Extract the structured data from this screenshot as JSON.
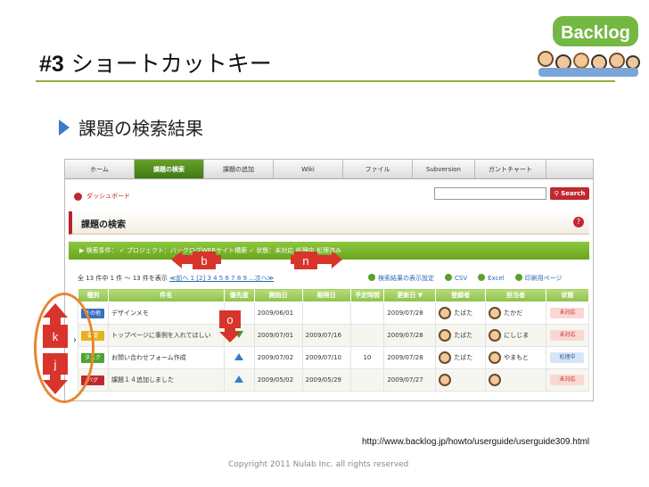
{
  "slide": {
    "number": "#3",
    "title": "ショートカットキー",
    "bullet": "課題の検索結果",
    "logo_text": "Backlog",
    "url": "http://www.backlog.jp/howto/userguide/userguide309.html",
    "copyright": "Copyright 2011 Nulab Inc. all rights reserved"
  },
  "app": {
    "nav_tabs": [
      "ホーム",
      "課題の検索",
      "課題の追加",
      "Wiki",
      "ファイル",
      "Subversion",
      "ガントチャート"
    ],
    "dashboard_label": "ダッシュボード",
    "search_button": "Search",
    "page_title": "課題の検索",
    "condition_text": "▶ 検索条件： ✓ プロジェクト：バックログWEBサイト構築 ✓ 状態：未対応 処理中 処理済み",
    "count_text": "全 13 件中 1 件 〜 13 件を表示",
    "pagination": "≪前へ  1  [2]  3  4  5  6  7  8  9  ...次へ≫",
    "links": [
      "検索結果の表示設定",
      "CSV",
      "Excel",
      "印刷用ページ"
    ],
    "columns": [
      "種別",
      "件名",
      "優先度",
      "開始日",
      "期限日",
      "予定時間",
      "更新日 ▼",
      "登録者",
      "担当者",
      "状態"
    ],
    "rows": [
      {
        "type": "その他",
        "type_color": "#3b6fbd",
        "subject": "デザインメモ",
        "prio": "",
        "start": "2009/06/01",
        "due": "",
        "est": "",
        "updated": "2009/07/28",
        "reporter": "たばた",
        "assignee": "たかだ",
        "status": "未対応",
        "status_bg": "#fbd7d2",
        "status_fg": "#c0282f"
      },
      {
        "type": "要望",
        "type_color": "#e8b21c",
        "subject": "トップページに事例を入れてほしい",
        "prio": "down",
        "start": "2009/07/01",
        "due": "2009/07/16",
        "est": "",
        "updated": "2009/07/28",
        "reporter": "たばた",
        "assignee": "にしじま",
        "status": "未対応",
        "status_bg": "#fbd7d2",
        "status_fg": "#c0282f"
      },
      {
        "type": "タスク",
        "type_color": "#4ea431",
        "subject": "お問い合わせフォーム作成",
        "prio": "up",
        "start": "2009/07/02",
        "due": "2009/07/10",
        "est": "10",
        "updated": "2009/07/28",
        "reporter": "たばた",
        "assignee": "やまもと",
        "status": "処理中",
        "status_bg": "#d5e6f7",
        "status_fg": "#2a5b9a"
      },
      {
        "type": "バグ",
        "type_color": "#c0282f",
        "subject": "課題１４追加しました",
        "prio": "up",
        "start": "2009/05/02",
        "due": "2009/05/29",
        "est": "",
        "updated": "2009/07/27",
        "reporter": "",
        "assignee": "",
        "status": "未対応",
        "status_bg": "#fbd7d2",
        "status_fg": "#c0282f"
      }
    ]
  },
  "keys": {
    "b": "b",
    "n": "n",
    "o": "o",
    "k": "k",
    "j": "j"
  }
}
